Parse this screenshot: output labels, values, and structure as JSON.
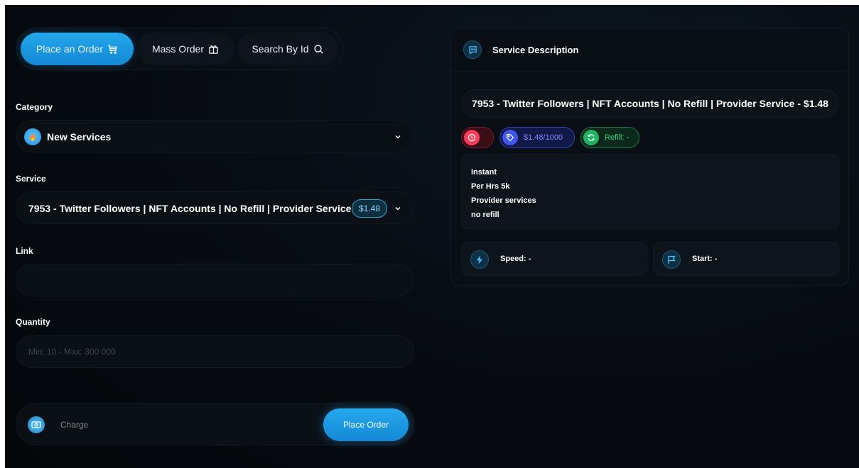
{
  "tabs": [
    {
      "label": "Place an Order",
      "icon": "cart-icon",
      "active": true
    },
    {
      "label": "Mass Order",
      "icon": "box-icon",
      "active": false
    },
    {
      "label": "Search By Id",
      "icon": "search-icon",
      "active": false
    }
  ],
  "form": {
    "category_label": "Category",
    "category_value": "New Services",
    "category_icon": "fire-icon",
    "service_label": "Service",
    "service_value": "7953 -  Twitter Followers | NFT Accounts | No Refill | Provider Service",
    "service_price": "$1.48",
    "link_label": "Link",
    "link_value": "",
    "quantity_label": "Quantity",
    "quantity_placeholder": "Min: 10 - Max: 300 000",
    "charge_label": "Charge",
    "submit_label": "Place Order"
  },
  "description": {
    "title": "Service Description",
    "service_title": "7953 - Twitter Followers | NFT Accounts | No Refill | Provider Service - $1.48",
    "rate": "$1.48/1000",
    "refill": "Refill: -",
    "lines": [
      "Instant",
      "Per Hrs 5k",
      "Provider services",
      "no refill"
    ],
    "speed": "Speed: -",
    "start": "Start: -"
  },
  "colors": {
    "accent": "#1e9be2",
    "background": "#070b10",
    "red": "#ff3b5c",
    "blue": "#3f56f0",
    "green": "#22b464"
  }
}
